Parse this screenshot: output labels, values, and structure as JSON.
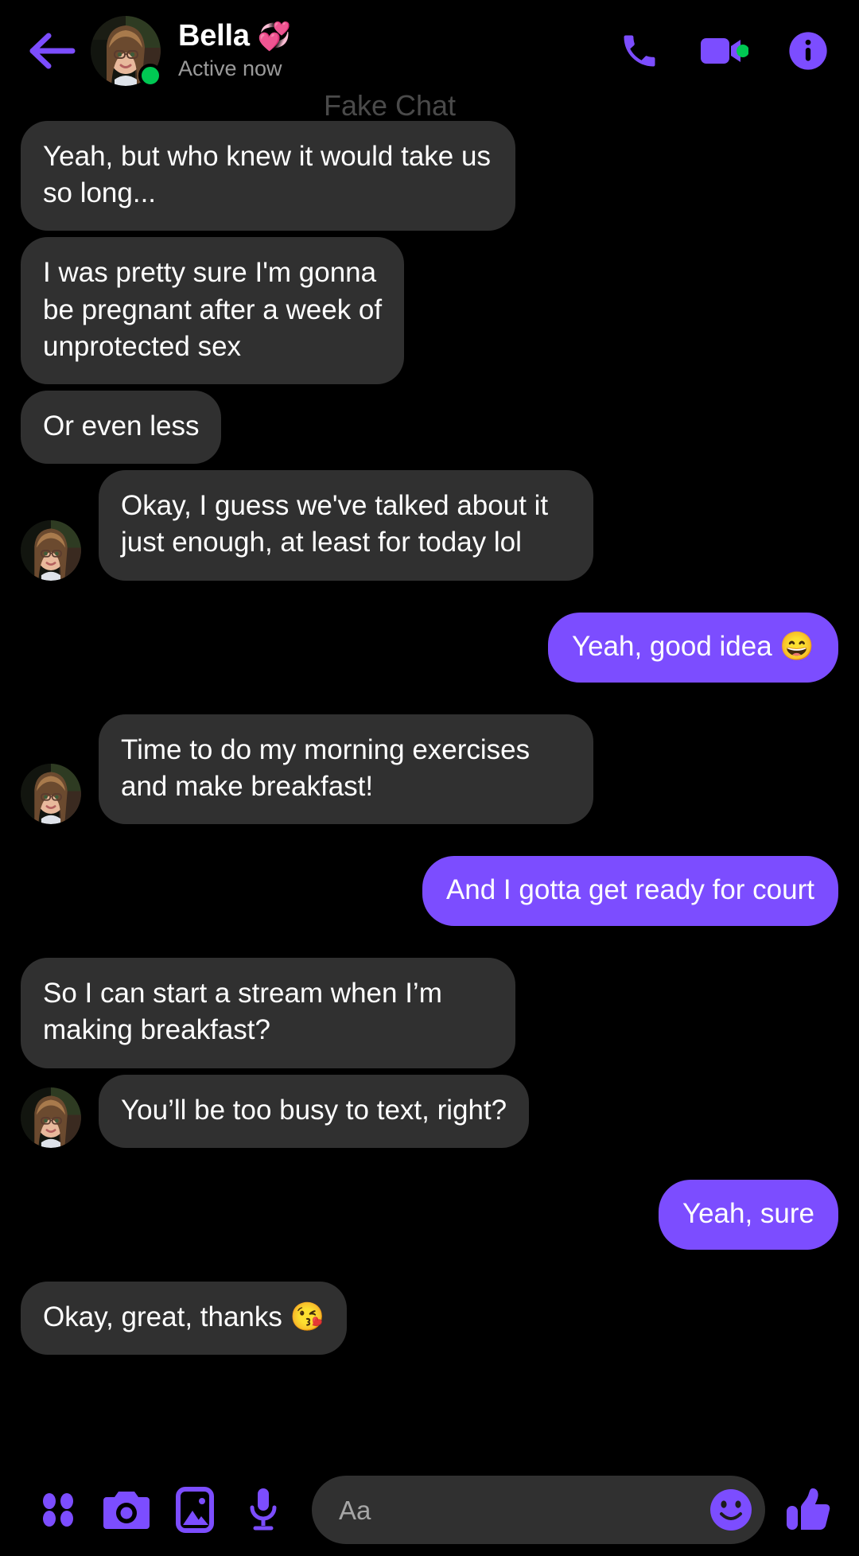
{
  "app": {
    "watermark": "Fake Chat",
    "accent_color": "#7C4DFF",
    "incoming_bubble_color": "#303030",
    "background_color": "#000000",
    "online_dot_color": "#00C853"
  },
  "header": {
    "back_icon": "arrow-left-icon",
    "contact_name": "Bella",
    "contact_name_emoji": "💞",
    "status": "Active now",
    "avatar_alt": "Bella profile photo",
    "online": true,
    "actions": [
      {
        "name": "voice-call-button",
        "icon": "phone-icon"
      },
      {
        "name": "video-call-button",
        "icon": "video-camera-icon"
      },
      {
        "name": "conversation-info-button",
        "icon": "info-circle-icon"
      }
    ]
  },
  "messages": [
    {
      "id": 1,
      "side": "incoming",
      "text": "Yeah, but who knew it would take us so long...",
      "avatar": false
    },
    {
      "id": 2,
      "side": "incoming",
      "text": "I was pretty sure I'm gonna\nbe pregnant after a week of\nunprotected sex",
      "avatar": false
    },
    {
      "id": 3,
      "side": "incoming",
      "text": "Or even less",
      "avatar": false
    },
    {
      "id": 4,
      "side": "incoming",
      "text": "Okay, I guess we've talked about it just enough, at least for today lol",
      "avatar": true
    },
    {
      "id": 5,
      "side": "outgoing",
      "text": "Yeah, good idea 😄",
      "avatar": false
    },
    {
      "id": 6,
      "side": "incoming",
      "text": "Time to do my morning exercises and make breakfast!",
      "avatar": true
    },
    {
      "id": 7,
      "side": "outgoing",
      "text": "And I gotta get ready for court",
      "avatar": false
    },
    {
      "id": 8,
      "side": "incoming",
      "text": "So I can start a stream when I’m making breakfast?",
      "avatar": false
    },
    {
      "id": 9,
      "side": "incoming",
      "text": "You’ll be too busy to text, right?",
      "avatar": true
    },
    {
      "id": 10,
      "side": "outgoing",
      "text": "Yeah, sure",
      "avatar": false
    },
    {
      "id": 11,
      "side": "incoming",
      "text": "Okay, great, thanks 😘",
      "avatar": false
    }
  ],
  "composer": {
    "placeholder": "Aa",
    "left_actions": [
      {
        "name": "more-apps-button",
        "icon": "four-dots-icon"
      },
      {
        "name": "camera-button",
        "icon": "camera-icon"
      },
      {
        "name": "gallery-button",
        "icon": "image-icon"
      },
      {
        "name": "voice-message-button",
        "icon": "microphone-icon"
      }
    ],
    "emoji_button": {
      "name": "emoji-picker-button",
      "icon": "smiley-icon"
    },
    "like_button": {
      "name": "thumbs-up-button",
      "icon": "thumbs-up-icon"
    }
  }
}
